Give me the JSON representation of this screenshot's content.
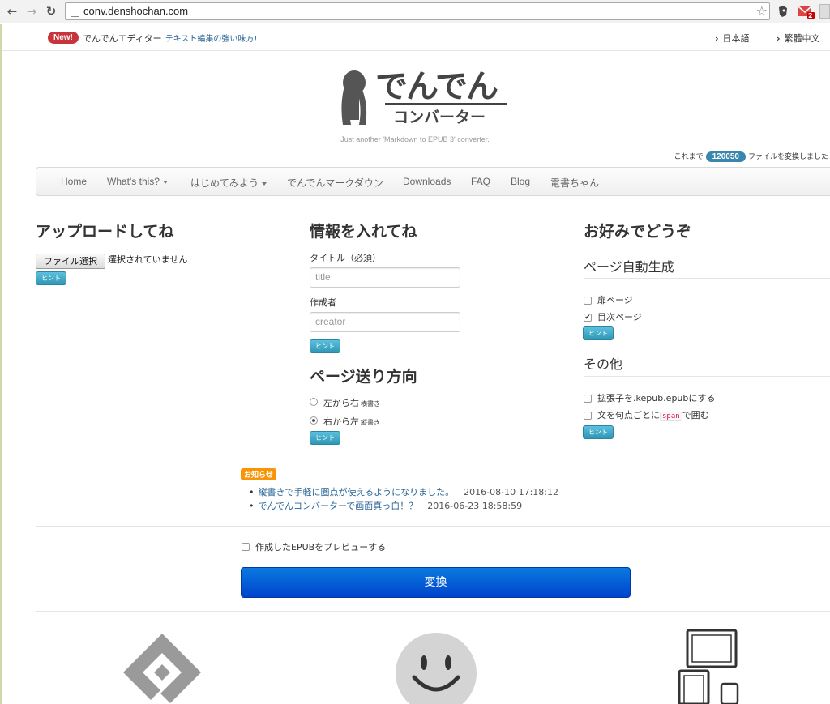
{
  "browser": {
    "url": "conv.denshochan.com",
    "mail_badge": "2"
  },
  "topbar": {
    "new_badge": "New!",
    "editor_name": "でんでんエディター",
    "editor_link": "テキスト編集の強い味方!",
    "lang_ja": "日本語",
    "lang_zh": "繁體中文"
  },
  "logo": {
    "title": "でんでん",
    "subtitle": "コンバーター",
    "tagline": "Just another 'Markdown to EPUB 3' converter."
  },
  "counter": {
    "prefix": "これまで",
    "count": "120050",
    "suffix": "ファイルを変換しました"
  },
  "nav": {
    "items": [
      "Home",
      "What's this?",
      "はじめてみよう",
      "でんでんマークダウン",
      "Downloads",
      "FAQ",
      "Blog",
      "電書ちゃん"
    ]
  },
  "upload": {
    "heading": "アップロードしてね",
    "file_button": "ファイル選択",
    "file_status": "選択されていません",
    "hint": "ヒント"
  },
  "info": {
    "heading": "情報を入れてね",
    "title_label": "タイトル（必須）",
    "title_placeholder": "title",
    "creator_label": "作成者",
    "creator_placeholder": "creator",
    "hint": "ヒント"
  },
  "direction": {
    "heading": "ページ送り方向",
    "ltr_label": "左から右",
    "ltr_note": "横書き",
    "rtl_label": "右から左",
    "rtl_note": "縦書き",
    "hint": "ヒント"
  },
  "prefs": {
    "heading": "お好みでどうぞ",
    "autogen_heading": "ページ自動生成",
    "cover_label": "扉ページ",
    "toc_label": "目次ページ",
    "hint": "ヒント",
    "other_heading": "その他",
    "kepub_label": "拡張子を.kepub.epubにする",
    "span_prefix": "文を句点ごとに",
    "span_code": "span",
    "span_suffix": "で囲む",
    "hint2": "ヒント"
  },
  "news": {
    "label": "お知らせ",
    "items": [
      {
        "title": "縦書きで手軽に圏点が使えるようになりました。",
        "date": "2016-08-10 17:18:12"
      },
      {
        "title": "でんでんコンバーターで画面真っ白！？",
        "date": "2016-06-23 18:58:59"
      }
    ]
  },
  "preview": {
    "label": "作成したEPUBをプレビューする"
  },
  "convert": {
    "label": "変換"
  },
  "colors": {
    "primary_button": "#0055cc",
    "hint_button": "#49afcd",
    "new_badge": "#c8343c",
    "count_badge": "#3a87ad",
    "news_badge": "#f89406"
  }
}
